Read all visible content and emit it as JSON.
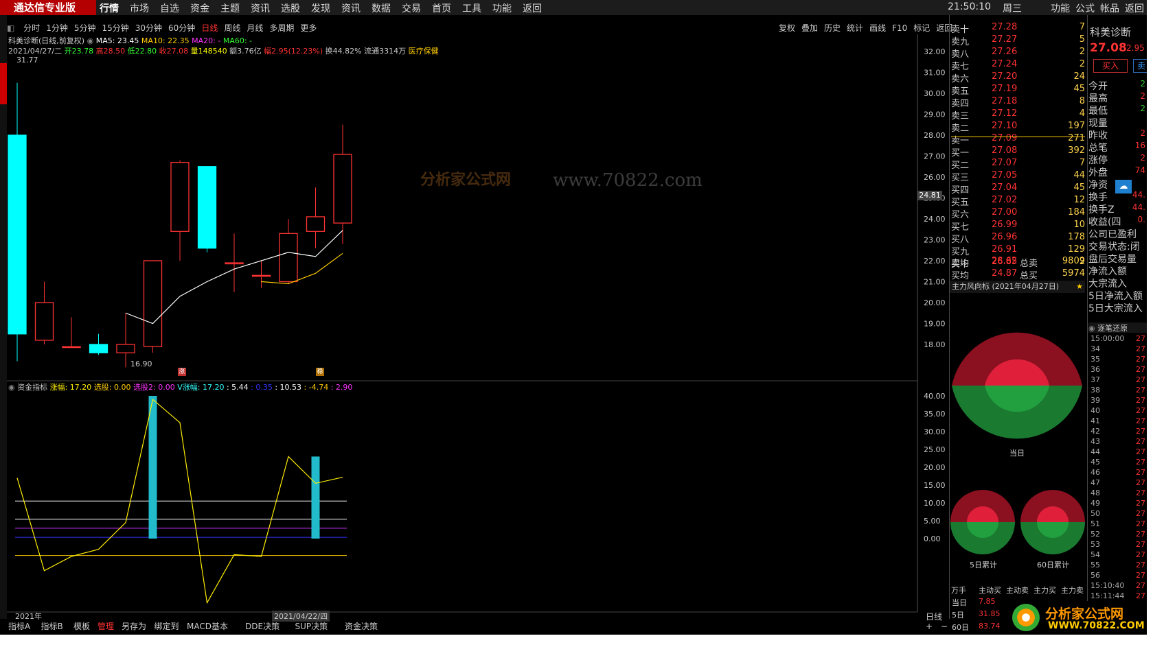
{
  "topnav": {
    "brand": "通达信专业版",
    "items": [
      "行情",
      "市场",
      "自选",
      "资金",
      "主题",
      "资讯",
      "选股",
      "发现",
      "资讯",
      "数据",
      "交易",
      "首页",
      "工具",
      "功能",
      "返回"
    ],
    "active": "行情",
    "time": "21:50:10",
    "weekday": "周三",
    "right_items": [
      "功能",
      "公式",
      "帐品",
      "返回"
    ]
  },
  "period_bar": {
    "items": [
      "分时",
      "1分钟",
      "5分钟",
      "15分钟",
      "30分钟",
      "60分钟",
      "日线",
      "周线",
      "月线",
      "多周期",
      "更多"
    ],
    "active": "日线"
  },
  "right_tools": [
    "复权",
    "叠加",
    "历史",
    "统计",
    "画线",
    "F10",
    "标记",
    "返回"
  ],
  "stock": {
    "title_line": "科美诊断(日线,前复权)",
    "ma5_label": "MA5: 23.45",
    "ma10_label": "MA10: 22.35",
    "ma20_label": "MA20: -",
    "ma60_label": "MA60: -",
    "date": "2021/04/27/二",
    "open_label": "开23.78",
    "high_label": "高28.50",
    "low_label": "低22.80",
    "close_label": "收27.08",
    "vol_label": "量148540",
    "amount_label": "额3.76亿",
    "change_label": "幅2.95(12.23%)",
    "turnover_label": "换44.82%",
    "float_label": "流通3314万",
    "sector_label": "医疗保健",
    "max_mark": "31.77",
    "min_mark": "16.90",
    "marker_up": "涨",
    "marker_b": "稳",
    "current_price_tag": "24.81"
  },
  "price_axis": [
    "32.00",
    "31.00",
    "30.00",
    "29.00",
    "28.00",
    "27.00",
    "26.00",
    "25.00",
    "24.00",
    "23.00",
    "22.00",
    "21.00",
    "20.00",
    "19.00",
    "18.00"
  ],
  "indicator": {
    "name": "资金指标",
    "l1": "涨幅: 17.20",
    "l2": "选股: 0.00",
    "l3": "选股2: 0.00",
    "l4": "V涨幅: 17.20",
    "l5": ": 5.44",
    "l6": ": 0.35",
    "l7": ": 10.53",
    "l8": ": -4.74",
    "l9": ": 2.90",
    "axis": [
      "40.00",
      "35.00",
      "30.00",
      "25.00",
      "20.00",
      "15.00",
      "10.00",
      "5.00",
      "0.00"
    ]
  },
  "chart_data": {
    "type": "candlestick",
    "candles": [
      {
        "o": 28.0,
        "c": 18.5,
        "h": 30.5,
        "l": 17.2
      },
      {
        "o": 18.2,
        "c": 20.0,
        "h": 21.0,
        "l": 18.0
      },
      {
        "o": 17.9,
        "c": 17.9,
        "h": 19.3,
        "l": 17.9
      },
      {
        "o": 18.0,
        "c": 17.6,
        "h": 18.5,
        "l": 17.5
      },
      {
        "o": 17.6,
        "c": 18.0,
        "h": 19.5,
        "l": 16.9
      },
      {
        "o": 17.9,
        "c": 22.0,
        "h": 22.0,
        "l": 17.6
      },
      {
        "o": 23.4,
        "c": 26.7,
        "h": 26.8,
        "l": 22.0
      },
      {
        "o": 26.5,
        "c": 22.6,
        "h": 26.5,
        "l": 22.4
      },
      {
        "o": 21.9,
        "c": 21.9,
        "h": 23.3,
        "l": 20.5
      },
      {
        "o": 21.3,
        "c": 21.3,
        "h": 22.0,
        "l": 20.7
      },
      {
        "o": 21.0,
        "c": 23.3,
        "h": 24.0,
        "l": 20.9
      },
      {
        "o": 23.4,
        "c": 24.1,
        "h": 25.5,
        "l": 22.6
      },
      {
        "o": 23.8,
        "c": 27.08,
        "h": 28.5,
        "l": 22.8
      }
    ],
    "ma5": [
      null,
      null,
      null,
      null,
      19.5,
      19.0,
      20.3,
      21.0,
      21.6,
      22.0,
      22.4,
      22.2,
      23.45
    ],
    "ma10": [
      null,
      null,
      null,
      null,
      null,
      null,
      null,
      null,
      null,
      21.0,
      20.9,
      21.4,
      22.35
    ],
    "ind_bars": [
      0,
      0,
      0,
      0,
      0,
      40.0,
      0,
      0,
      0,
      0,
      0,
      23.0,
      0
    ],
    "ind_line": [
      17.0,
      -9.0,
      -5.0,
      -3.0,
      4.5,
      39.0,
      32.5,
      -18.0,
      -4.5,
      -5.0,
      23.0,
      15.5,
      17.2
    ],
    "hlines": [
      10.53,
      5.44,
      2.9,
      0.35,
      -4.74
    ],
    "dates": [
      "2021年",
      "2021/04/22/四"
    ]
  },
  "orderbook": {
    "asks": [
      {
        "n": "卖十",
        "p": "27.28",
        "v": "7"
      },
      {
        "n": "卖九",
        "p": "27.27",
        "v": "5"
      },
      {
        "n": "卖八",
        "p": "27.26",
        "v": "2"
      },
      {
        "n": "卖七",
        "p": "27.24",
        "v": "2"
      },
      {
        "n": "卖六",
        "p": "27.20",
        "v": "24"
      },
      {
        "n": "卖五",
        "p": "27.19",
        "v": "45"
      },
      {
        "n": "卖四",
        "p": "27.18",
        "v": "8"
      },
      {
        "n": "卖三",
        "p": "27.12",
        "v": "4"
      },
      {
        "n": "卖二",
        "p": "27.10",
        "v": "197"
      },
      {
        "n": "卖一",
        "p": "27.09",
        "v": "271"
      }
    ],
    "bids": [
      {
        "n": "买一",
        "p": "27.08",
        "v": "392"
      },
      {
        "n": "买二",
        "p": "27.07",
        "v": "7"
      },
      {
        "n": "买三",
        "p": "27.05",
        "v": "44"
      },
      {
        "n": "买四",
        "p": "27.04",
        "v": "45"
      },
      {
        "n": "买五",
        "p": "27.02",
        "v": "12"
      },
      {
        "n": "买六",
        "p": "27.00",
        "v": "184"
      },
      {
        "n": "买七",
        "p": "26.99",
        "v": "10"
      },
      {
        "n": "买八",
        "p": "26.96",
        "v": "178"
      },
      {
        "n": "买九",
        "p": "26.91",
        "v": "129"
      },
      {
        "n": "买十",
        "p": "26.85",
        "v": "2"
      }
    ],
    "avg_sell_label": "卖均",
    "avg_sell": "28.62",
    "total_sell_label": "总卖",
    "total_sell": "9809",
    "avg_buy_label": "买均",
    "avg_buy": "24.87",
    "total_buy_label": "总买",
    "total_buy": "5974"
  },
  "fund_flow": {
    "title": "主力风向标 (2021年04月27日)",
    "today_label": "当日",
    "five_label": "5日累计",
    "sixty_label": "60日累计",
    "headers": [
      "万手",
      "主动买",
      "主动卖",
      "主力买",
      "主力卖"
    ],
    "rows": [
      {
        "label": "当日",
        "v1": "7.85"
      },
      {
        "label": "5日",
        "v1": "31.85"
      },
      {
        "label": "60日",
        "v1": "83.74"
      }
    ]
  },
  "quote": {
    "name": "科美诊断",
    "price": "27.08",
    "change": "2.95",
    "buy_btn": "买入",
    "sell_btn": "卖",
    "rows": [
      {
        "k": "今开",
        "v": "2"
      },
      {
        "k": "最高",
        "v": "2"
      },
      {
        "k": "最低",
        "v": "2"
      },
      {
        "k": "现量",
        "v": ""
      },
      {
        "k": "昨收",
        "v": "2"
      },
      {
        "k": "总笔",
        "v": "16"
      },
      {
        "k": "涨停",
        "v": "2"
      },
      {
        "k": "外盘",
        "v": "74"
      },
      {
        "k": "净资",
        "v": ""
      },
      {
        "k": "换手",
        "v": "44."
      },
      {
        "k": "换手Z",
        "v": "44."
      },
      {
        "k": "收益(四",
        "v": "0."
      },
      {
        "k": "公司已盈利",
        "v": ""
      },
      {
        "k": "交易状态:闭",
        "v": ""
      },
      {
        "k": "盘后交易量",
        "v": ""
      },
      {
        "k": "净流入额",
        "v": ""
      },
      {
        "k": "大宗流入",
        "v": ""
      },
      {
        "k": "5日净流入额",
        "v": ""
      },
      {
        "k": "5日大宗流入",
        "v": ""
      }
    ],
    "tick_title": "逐笔还原"
  },
  "ticks": [
    {
      "t": "15:00:00",
      "v": "27"
    },
    {
      "t": "34",
      "v": "27"
    },
    {
      "t": "35",
      "v": "27"
    },
    {
      "t": "36",
      "v": "27"
    },
    {
      "t": "37",
      "v": "27"
    },
    {
      "t": "38",
      "v": "27"
    },
    {
      "t": "39",
      "v": "27"
    },
    {
      "t": "40",
      "v": "27"
    },
    {
      "t": "41",
      "v": "27"
    },
    {
      "t": "42",
      "v": "27"
    },
    {
      "t": "43",
      "v": "27"
    },
    {
      "t": "44",
      "v": "27"
    },
    {
      "t": "45",
      "v": "27"
    },
    {
      "t": "46",
      "v": "27"
    },
    {
      "t": "47",
      "v": "27"
    },
    {
      "t": "48",
      "v": "27"
    },
    {
      "t": "49",
      "v": "27"
    },
    {
      "t": "50",
      "v": "27"
    },
    {
      "t": "51",
      "v": "27"
    },
    {
      "t": "52",
      "v": "27"
    },
    {
      "t": "53",
      "v": "27"
    },
    {
      "t": "54",
      "v": "27"
    },
    {
      "t": "55",
      "v": "27"
    },
    {
      "t": "56",
      "v": "27"
    },
    {
      "t": "15:10:40",
      "v": "27"
    },
    {
      "t": "15:11:44",
      "v": "27"
    }
  ],
  "bottom_tabs": [
    "指标A",
    "指标B",
    "模板",
    "管理",
    "另存为",
    "绑定到",
    "MACD基本",
    "DDE决策",
    "SUP决策",
    "资金决策"
  ],
  "bottom_active": "管理",
  "period_label": "日线",
  "watermark": {
    "text1": "分析家公式网",
    "text2": "www.70822.com",
    "brand": "分析家公式网",
    "brand_url": "WWW.70822.COM"
  },
  "colors": {
    "up": "#ff3333",
    "down": "#00ffff",
    "ma5": "#ffffff",
    "ma10": "#ffcc00",
    "ind": "#ffee00"
  }
}
